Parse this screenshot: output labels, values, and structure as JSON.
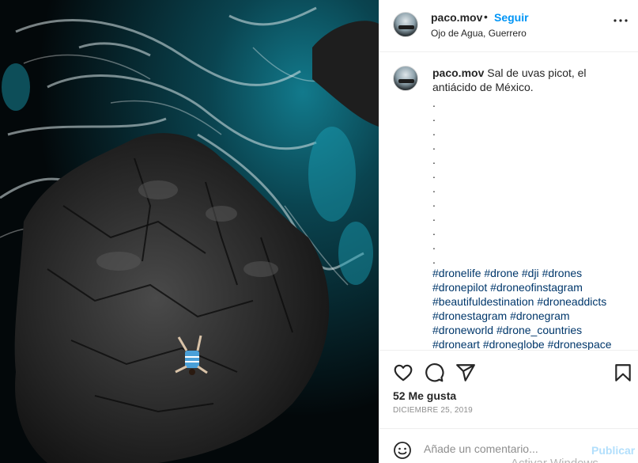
{
  "header": {
    "username": "paco.mov",
    "separator": "•",
    "follow_label": "Seguir",
    "location": "Ojo de Agua, Guerrero"
  },
  "caption": {
    "username": "paco.mov",
    "text": "Sal de uvas picot, el antiácido de México.",
    "dots": [
      ".",
      ".",
      ".",
      ".",
      ".",
      ".",
      ".",
      ".",
      ".",
      ".",
      ".",
      "."
    ],
    "hashtags": [
      "#dronelife",
      "#drone",
      "#dji",
      "#drones",
      "#dronepilot",
      "#droneofinstagram",
      "#beautifuldestination",
      "#droneaddicts",
      "#dronestagram",
      "#dronegram",
      "#droneworld",
      "#drone_countries",
      "#droneart",
      "#droneglobe",
      "#dronespace"
    ]
  },
  "actions": {
    "like_icon": "heart-icon",
    "comment_icon": "comment-icon",
    "share_icon": "paper-plane-icon",
    "save_icon": "bookmark-icon"
  },
  "likes_text": "52 Me gusta",
  "date_text": "DICIEMBRE 25, 2019",
  "comment_box": {
    "placeholder": "Añade un comentario...",
    "publish_label": "Publicar"
  },
  "watermark_text": "Activar Windows",
  "colors": {
    "accent": "#0095f6",
    "hashtag": "#00376b",
    "publish_disabled": "#b2dffc",
    "muted": "#8e8e8e"
  }
}
